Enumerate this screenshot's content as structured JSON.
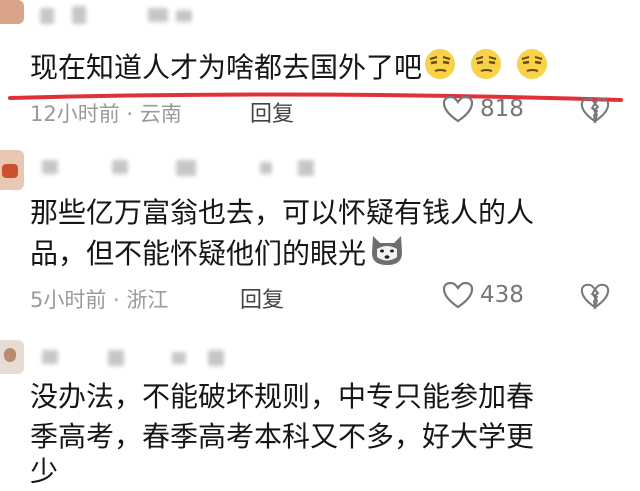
{
  "comments": [
    {
      "text_line1": "现在知道人才为啥都去国外了吧",
      "emoji": "skeptical-face-emoji",
      "time_location": "12小时前 · 云南",
      "reply_label": "回复",
      "likes": "818"
    },
    {
      "text_line1": "那些亿万富翁也去，可以怀疑有钱人的人",
      "text_line2": "品，但不能怀疑他们的眼光",
      "emoji": "dog-face-emoji",
      "time_location": "5小时前 · 浙江",
      "reply_label": "回复",
      "likes": "438"
    },
    {
      "text_line1": "没办法，不能破坏规则，中专只能参加春",
      "text_line2": "季高考，春季高考本科又不多，好大学更",
      "text_line3": "少"
    }
  ],
  "colors": {
    "highlight_underline": "#e0303a",
    "meta": "#9a9a9a"
  }
}
